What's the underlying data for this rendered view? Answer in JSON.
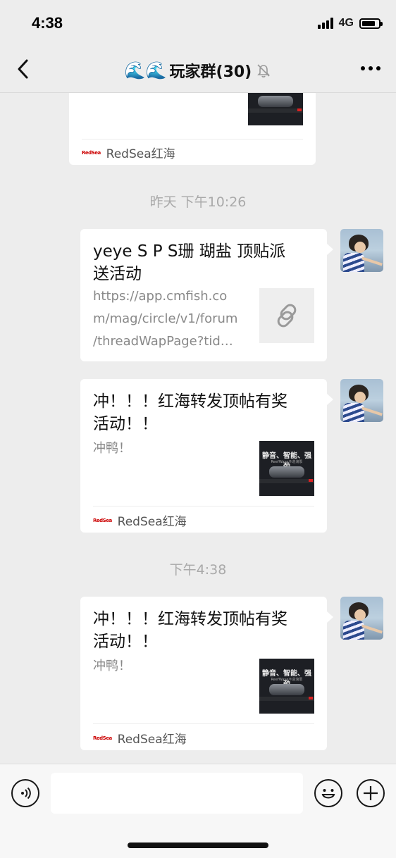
{
  "status_bar": {
    "time": "4:38",
    "network": "4G",
    "battery_level": 0.8
  },
  "nav": {
    "title": "玩家群(30)",
    "title_emoji": "🌊🌊",
    "back_icon": "chevron-left-icon",
    "mute_icon": "bell-off-icon",
    "more_icon": "more-dots-icon"
  },
  "messages": [
    {
      "type": "article-card-partial",
      "source": "RedSea红海",
      "source_logo": "RedSea"
    },
    {
      "type": "timestamp",
      "text": "昨天 下午10:26"
    },
    {
      "type": "link-card",
      "title": "yeye S P S珊 瑚盐 顶贴派送活动",
      "desc": "https://app.cmfish.com/mag/circle/v1/forum/threadWapPage?tid…",
      "desc_lines": [
        "https://app.cmfish.co",
        "m/mag/circle/v1/forum",
        "/threadWapPage?tid…"
      ],
      "title_lines": [
        "yeye S P S珊 瑚盐 顶贴派",
        "送活动"
      ],
      "thumb_icon": "link-icon"
    },
    {
      "type": "article-card",
      "title_lines": [
        "冲！！！红海转发顶帖有奖",
        "活动！！"
      ],
      "desc": "冲鸭！",
      "source": "RedSea红海",
      "source_logo": "RedSea",
      "thumb_text": "静音、智能、强劲",
      "thumb_sub": "ReefWave®造浪泵"
    },
    {
      "type": "timestamp",
      "text": "下午4:38"
    },
    {
      "type": "article-card",
      "title_lines": [
        "冲！！！红海转发顶帖有奖",
        "活动！！"
      ],
      "desc": "冲鸭！",
      "source": "RedSea红海",
      "source_logo": "RedSea",
      "thumb_text": "静音、智能、强劲",
      "thumb_sub": "ReefWave®造浪泵"
    }
  ],
  "input_bar": {
    "voice_icon": "voice-icon",
    "emoji_icon": "emoji-icon",
    "plus_icon": "plus-icon",
    "input_value": ""
  }
}
